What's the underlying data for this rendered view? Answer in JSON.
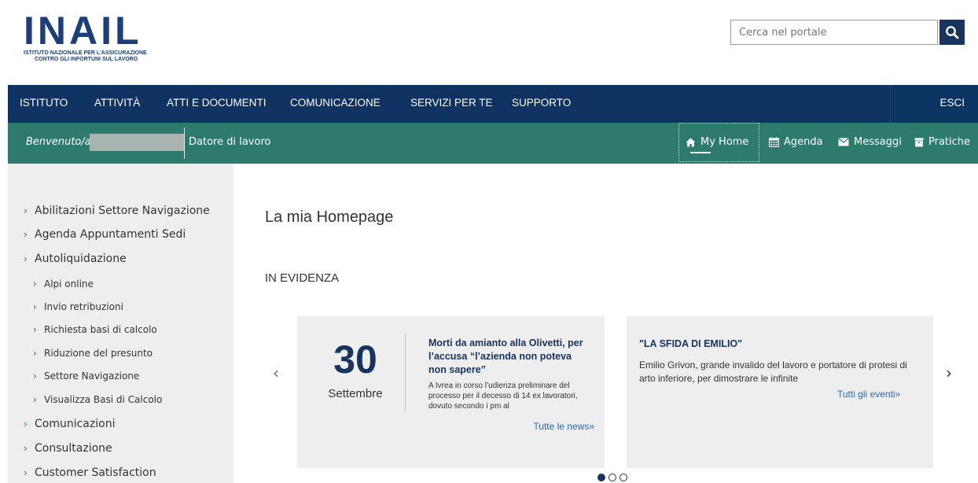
{
  "logo": {
    "word": "INAIL",
    "subtitle_line1": "ISTITUTO NAZIONALE PER L'ASSICURAZIONE",
    "subtitle_line2": "CONTRO GLI INFORTUNI SUL LAVORO"
  },
  "search": {
    "placeholder": "Cerca nel portale"
  },
  "topnav": {
    "items": [
      "ISTITUTO",
      "ATTIVITÀ",
      "ATTI E DOCUMENTI",
      "COMUNICAZIONE",
      "SERVIZI PER TE",
      "SUPPORTO"
    ],
    "logout": "ESCI"
  },
  "subnav": {
    "welcome": "Benvenuto/a",
    "role": "Datore di lavoro",
    "links": [
      "My Home",
      "Agenda",
      "Messaggi",
      "Pratiche"
    ]
  },
  "sidebar": {
    "items": [
      "Abilitazioni Settore Navigazione",
      "Agenda Appuntamenti Sedi",
      "Autoliquidazione",
      "Alpi online",
      "Invio retribuzioni",
      "Richiesta basi di calcolo",
      "Riduzione del presunto",
      "Settore Navigazione",
      "Visualizza Basi di Calcolo",
      "Comunicazioni",
      "Consultazione",
      "Customer Satisfaction"
    ]
  },
  "main": {
    "title": "La mia Homepage",
    "section": "IN EVIDENZA",
    "news": {
      "day": "30",
      "month": "Settembre",
      "title": "Morti da amianto alla Olivetti, per l’accusa “l’azienda non poteva non sapere”",
      "text": "A Ivrea in corso l’udienza preliminare del processo per il decesso di 14 ex lavoratori, dovuto secondo i pm al",
      "link": "Tutte le news»"
    },
    "event": {
      "title": "\"LA SFIDA DI EMILIO\"",
      "text": "Emilio Grivon, grande invalido del lavoro e portatore di protesi di arto inferiore, per dimostrare le infinite",
      "link": "Tutti gli eventi»"
    },
    "carousel": {
      "prev": "‹",
      "next": "›"
    }
  },
  "colors": {
    "primary": "#0e3261",
    "green": "#2d7b6d",
    "sidebar_bg": "#eeeeee",
    "link": "#2b6bb0"
  }
}
